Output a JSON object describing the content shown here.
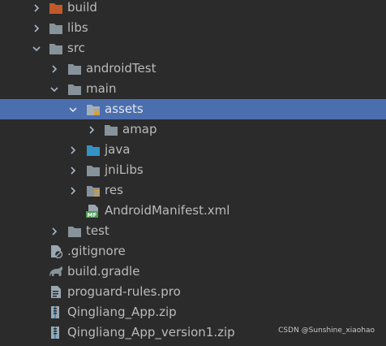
{
  "tree": {
    "build": "build",
    "libs": "libs",
    "src": "src",
    "androidTest": "androidTest",
    "main": "main",
    "assets": "assets",
    "amap": "amap",
    "java": "java",
    "jniLibs": "jniLibs",
    "res": "res",
    "manifest": "AndroidManifest.xml",
    "manifest_badge": "MF",
    "test": "test",
    "gitignore": ".gitignore",
    "build_gradle": "build.gradle",
    "proguard": "proguard-rules.pro",
    "zip1": "Qingliang_App.zip",
    "zip2": "Qingliang_App_version1.zip"
  },
  "watermark": "CSDN @Sunshine_xiaohao",
  "colors": {
    "background": "#2b2b2b",
    "selection": "#4b6eaf",
    "folder": "#87939a",
    "build_folder": "#c05a2a",
    "source_folder": "#3592c4",
    "resource_marker": "#d69c3c"
  },
  "icons": {
    "build": "excluded-folder-icon",
    "folder": "folder-icon",
    "java": "source-folder-icon",
    "res": "resource-folder-icon",
    "manifest": "manifest-file-icon",
    "gitignore": "ignore-file-icon",
    "gradle": "gradle-icon",
    "text": "text-file-icon",
    "zip": "zip-file-icon"
  }
}
